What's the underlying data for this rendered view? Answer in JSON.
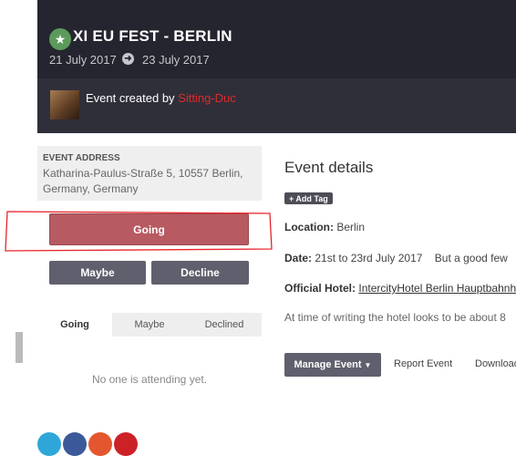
{
  "event": {
    "title": "XI EU FEST - BERLIN",
    "start_date": "21 July 2017",
    "end_date": "23 July 2017",
    "created_prefix": "Event created by ",
    "created_by": "Sitting-Duc"
  },
  "address": {
    "label": "EVENT ADDRESS",
    "text": "Katharina-Paulus-Straße 5, 10557 Berlin, Germany, Germany"
  },
  "rsvp": {
    "going": "Going",
    "maybe": "Maybe",
    "decline": "Decline"
  },
  "attendee_tabs": {
    "going": "Going",
    "maybe": "Maybe",
    "declined": "Declined",
    "empty_message": "No one is attending yet."
  },
  "details": {
    "heading": "Event details",
    "add_tag": "+ Add Tag",
    "location_label": "Location:",
    "location_value": " Berlin",
    "date_label": "Date:",
    "date_value": " 21st to 23rd July 2017    But a good few",
    "hotel_label": "Official Hotel:",
    "hotel_value": "IntercityHotel Berlin Hauptbahnh",
    "note": "At time of writing the hotel looks to be about 8"
  },
  "actions": {
    "manage": "Manage Event",
    "report": "Report Event",
    "download": "Download"
  },
  "colors": {
    "header_bg": "#25252f",
    "going_button": "#b75a62",
    "dark_button": "#5f5f6d",
    "creator_link": "#e02a2a",
    "annotation_outline": "#e8252a"
  }
}
